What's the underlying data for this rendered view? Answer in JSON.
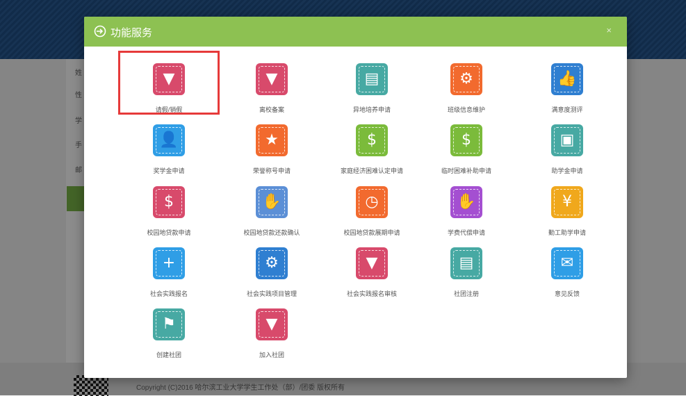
{
  "modal": {
    "title": "功能服务",
    "close_label": "×"
  },
  "footer": {
    "copyright": "Copyright (C)2016 哈尔滨工业大学学生工作处（部）/团委 版权所有"
  },
  "background": {
    "side_labels": [
      "姓",
      "性",
      "学",
      "手",
      "邮"
    ]
  },
  "colors": {
    "header_green": "#8dc152",
    "selected_outline": "#e63a3a",
    "pink": "#d84a6b",
    "blue": "#2f9ee6",
    "green": "#7bbb3b",
    "orange": "#f26a2e",
    "teal": "#47a9a3",
    "purple": "#a44fd1"
  },
  "services": [
    {
      "label": "请假/销假",
      "icon": "shield-badge-icon",
      "color": "#d84a6b",
      "glyph": "▼",
      "selected": true
    },
    {
      "label": "离校备案",
      "icon": "shield-badge-icon",
      "color": "#d84a6b",
      "glyph": "▼"
    },
    {
      "label": "异地培养申请",
      "icon": "document-search-icon",
      "color": "#47a9a3",
      "glyph": "▤"
    },
    {
      "label": "班级信息维护",
      "icon": "gears-icon",
      "color": "#f26a2e",
      "glyph": "⚙"
    },
    {
      "label": "满意度测评",
      "icon": "thumbs-up-icon",
      "color": "#2f7fd1",
      "glyph": "👍"
    },
    {
      "label": "奖学金申请",
      "icon": "user-money-icon",
      "color": "#2f9ee6",
      "glyph": "👤"
    },
    {
      "label": "荣誉称号申请",
      "icon": "medal-icon",
      "color": "#f26a2e",
      "glyph": "★"
    },
    {
      "label": "家庭经济困难认定申请",
      "icon": "money-bag-icon",
      "color": "#7bbb3b",
      "glyph": "$"
    },
    {
      "label": "临时困难补助申请",
      "icon": "money-bag-icon",
      "color": "#7bbb3b",
      "glyph": "$"
    },
    {
      "label": "助学金申请",
      "icon": "briefcase-icon",
      "color": "#47a9a3",
      "glyph": "▣"
    },
    {
      "label": "校园地贷款申请",
      "icon": "coin-hand-icon",
      "color": "#d84a6b",
      "glyph": "$"
    },
    {
      "label": "校园地贷款还款确认",
      "icon": "cash-hand-icon",
      "color": "#5b8fd6",
      "glyph": "✋"
    },
    {
      "label": "校园地贷款展期申请",
      "icon": "folder-clock-icon",
      "color": "#f26a2e",
      "glyph": "◷"
    },
    {
      "label": "学费代偿申请",
      "icon": "hand-coin-icon",
      "color": "#a44fd1",
      "glyph": "✋"
    },
    {
      "label": "勤工助学申请",
      "icon": "hand-yen-icon",
      "color": "#f0a81c",
      "glyph": "¥"
    },
    {
      "label": "社会实践报名",
      "icon": "add-users-icon",
      "color": "#2f9ee6",
      "glyph": "+"
    },
    {
      "label": "社会实践项目管理",
      "icon": "group-settings-icon",
      "color": "#2f7fd1",
      "glyph": "⚙"
    },
    {
      "label": "社会实践报名审核",
      "icon": "shield-badge-icon",
      "color": "#d84a6b",
      "glyph": "▼"
    },
    {
      "label": "社团注册",
      "icon": "document-search-icon",
      "color": "#47a9a3",
      "glyph": "▤"
    },
    {
      "label": "意见反馈",
      "icon": "chat-bubbles-icon",
      "color": "#2f9ee6",
      "glyph": "✉"
    },
    {
      "label": "创建社团",
      "icon": "flag-add-icon",
      "color": "#47a9a3",
      "glyph": "⚑"
    },
    {
      "label": "加入社团",
      "icon": "shield-badge-icon",
      "color": "#d84a6b",
      "glyph": "▼"
    }
  ]
}
